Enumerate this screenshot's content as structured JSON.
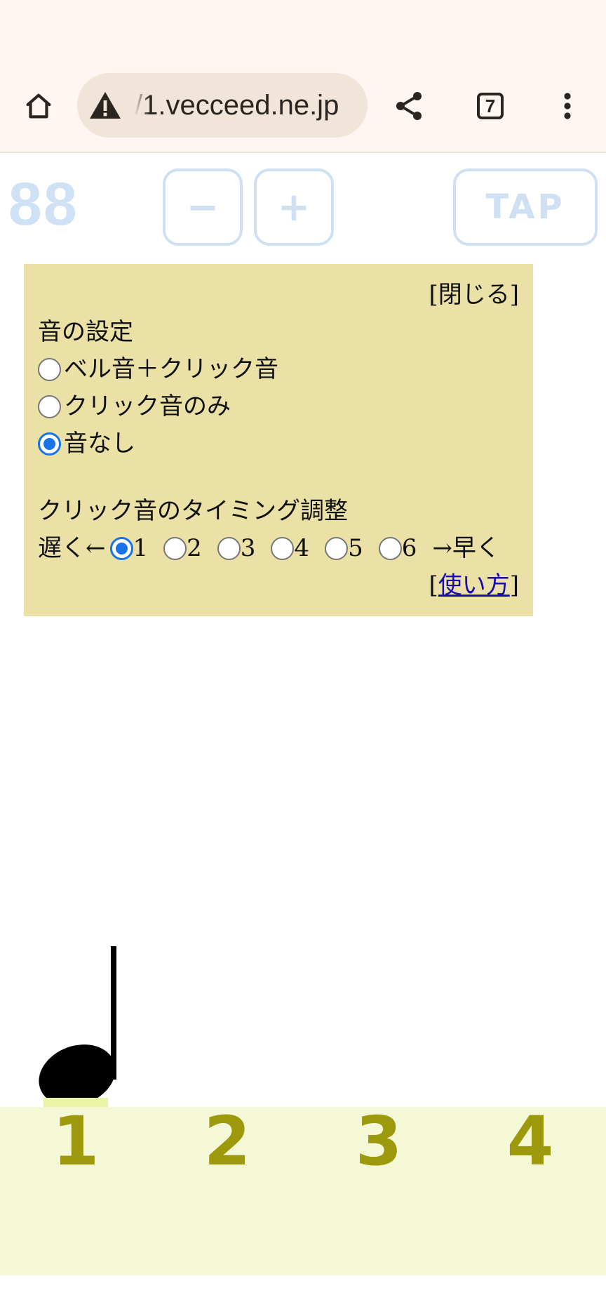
{
  "browser": {
    "url": "/1.vecceed.ne.jp",
    "tab_count": "7",
    "icons": [
      "home-icon",
      "warning-icon",
      "share-icon",
      "tabs-icon",
      "menu-icon"
    ]
  },
  "toolbar": {
    "bpm": "88",
    "minus_label": "−",
    "plus_label": "+",
    "tap_label": "TAP"
  },
  "settings": {
    "close_label": "[閉じる]",
    "sound_heading": "音の設定",
    "sound_options": [
      {
        "label": "ベル音＋クリック音",
        "selected": false
      },
      {
        "label": "クリック音のみ",
        "selected": false
      },
      {
        "label": "音なし",
        "selected": true
      }
    ],
    "timing_heading": "クリック音のタイミング調整",
    "timing_slow": "遅く←",
    "timing_fast": "→早く",
    "timing_options": [
      {
        "label": "1",
        "selected": true
      },
      {
        "label": "2",
        "selected": false
      },
      {
        "label": "3",
        "selected": false
      },
      {
        "label": "4",
        "selected": false
      },
      {
        "label": "5",
        "selected": false
      },
      {
        "label": "6",
        "selected": false
      }
    ],
    "help_open": "[",
    "help_link": "使い方",
    "help_close": "]"
  },
  "beats": {
    "labels": [
      "1",
      "2",
      "3",
      "4"
    ],
    "active": "1"
  },
  "colors": {
    "accent": "#1a73e8",
    "panel_bg": "#ebe1a6",
    "beat_bg": "#f5f8d6",
    "beat_text": "#9c9a0c",
    "toolbar_faded": "#cfe0f3"
  }
}
